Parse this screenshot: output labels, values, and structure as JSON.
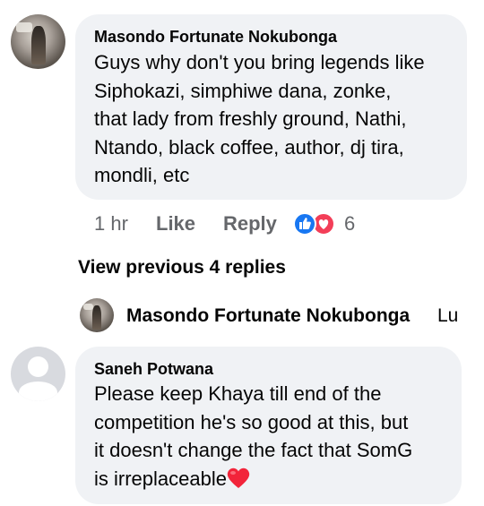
{
  "comment1": {
    "author": "Masondo Fortunate Nokubonga",
    "lines": [
      "Guys why don't you bring legends like",
      "Siphokazi, simphiwe dana, zonke,",
      "that lady from freshly ground, Nathi,",
      "Ntando, black coffee, author, dj tira,",
      "mondli, etc"
    ],
    "time": "1 hr",
    "like_label": "Like",
    "reply_label": "Reply",
    "reaction_count": "6",
    "reaction_icons": [
      "like-icon",
      "love-icon"
    ]
  },
  "view_previous_replies": "View previous 4 replies",
  "reply_preview": {
    "author": "Masondo Fortunate Nokubonga",
    "snippet": "Lu"
  },
  "comment2": {
    "author": "Saneh Potwana",
    "lines": [
      "Please keep Khaya till end of the",
      "competition he's so good at this, but",
      "it doesn't change the fact that SomG",
      "is irreplaceable"
    ],
    "emoji": "heart-emoji"
  },
  "colors": {
    "bubble": "#f0f2f5",
    "secondary_text": "#65676b",
    "like_blue": "#1877f2",
    "love_red": "#f33e58"
  }
}
